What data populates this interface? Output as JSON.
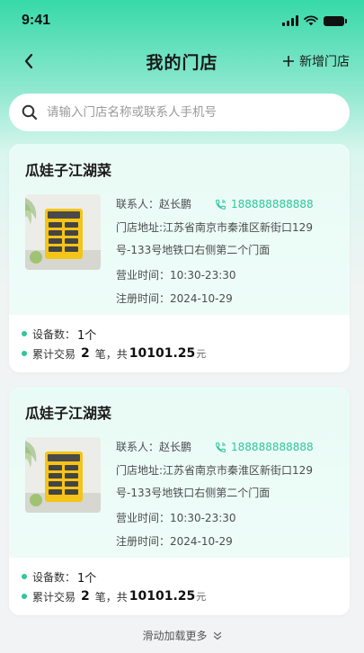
{
  "status_bar": {
    "time": "9:41"
  },
  "nav": {
    "title": "我的门店",
    "add_label": "新增门店"
  },
  "search": {
    "placeholder": "请输入门店名称或联系人手机号",
    "value": ""
  },
  "stores": [
    {
      "name": "瓜娃子江湖菜",
      "contact_label": "联系人：",
      "contact_name": "赵长鹏",
      "phone": "188888888888",
      "address_label": "门店地址:",
      "address": "江苏省南京市秦淮区新街口129号-133号地铁口右侧第二个门面",
      "hours_label": "营业时间：",
      "hours": "10:30-23:30",
      "reg_label": "注册时间：",
      "reg_date": "2024-10-29",
      "device_label": "设备数：",
      "device_count": "1个",
      "trade_label": "累计交易",
      "trade_count": "2",
      "trade_mid": "笔，共",
      "trade_amount": "10101.25",
      "trade_unit": "元"
    },
    {
      "name": "瓜娃子江湖菜",
      "contact_label": "联系人：",
      "contact_name": "赵长鹏",
      "phone": "188888888888",
      "address_label": "门店地址:",
      "address": "江苏省南京市秦淮区新街口129号-133号地铁口右侧第二个门面",
      "hours_label": "营业时间：",
      "hours": "10:30-23:30",
      "reg_label": "注册时间：",
      "reg_date": "2024-10-29",
      "device_label": "设备数：",
      "device_count": "1个",
      "trade_label": "累计交易",
      "trade_count": "2",
      "trade_mid": "笔，共",
      "trade_amount": "10101.25",
      "trade_unit": "元"
    }
  ],
  "footer": {
    "load_more": "滑动加载更多"
  },
  "colors": {
    "accent": "#2fc79a",
    "header_green": "#37d9a9",
    "card_top": "#e9fbf6"
  },
  "icons": [
    "back-icon",
    "plus-icon",
    "search-icon",
    "phone-icon",
    "double-chevron-down-icon",
    "signal-icon",
    "wifi-icon",
    "battery-icon"
  ]
}
